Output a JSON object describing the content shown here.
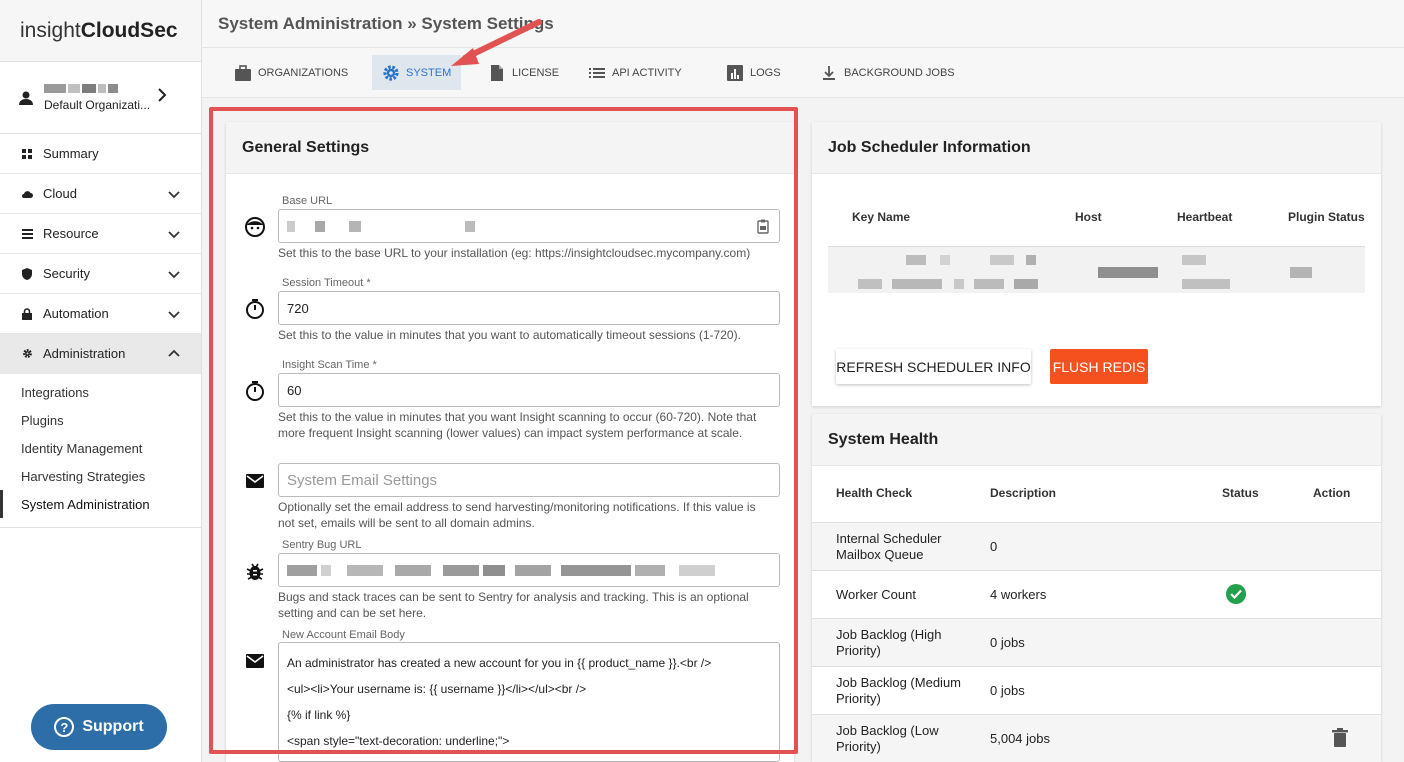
{
  "app": {
    "logo_light": "insight",
    "logo_bold": "CloudSec"
  },
  "org": {
    "name": "Default Organizati..."
  },
  "nav": {
    "items": [
      {
        "label": "Summary",
        "icon": "grid-icon"
      },
      {
        "label": "Cloud",
        "icon": "cloud-icon"
      },
      {
        "label": "Resource",
        "icon": "list-icon"
      },
      {
        "label": "Security",
        "icon": "shield-icon"
      },
      {
        "label": "Automation",
        "icon": "lock-icon"
      },
      {
        "label": "Administration",
        "icon": "gear-icon"
      }
    ],
    "sub_items": [
      {
        "label": "Integrations"
      },
      {
        "label": "Plugins"
      },
      {
        "label": "Identity Management"
      },
      {
        "label": "Harvesting Strategies"
      },
      {
        "label": "System Administration"
      }
    ]
  },
  "support": {
    "label": "Support"
  },
  "header": {
    "title": "System Administration » System Settings"
  },
  "tabs": [
    {
      "label": "ORGANIZATIONS",
      "icon": "briefcase-icon"
    },
    {
      "label": "SYSTEM",
      "icon": "gear-icon"
    },
    {
      "label": "LICENSE",
      "icon": "document-icon"
    },
    {
      "label": "API ACTIVITY",
      "icon": "list-icon"
    },
    {
      "label": "LOGS",
      "icon": "bar-chart-icon"
    },
    {
      "label": "BACKGROUND JOBS",
      "icon": "download-icon"
    }
  ],
  "general": {
    "title": "General Settings",
    "base_url": {
      "label": "Base URL",
      "help": "Set this to the base URL to your installation (eg: https://insightcloudsec.mycompany.com)"
    },
    "session_timeout": {
      "label": "Session Timeout *",
      "value": "720",
      "help": "Set this to the value in minutes that you want to automatically timeout sessions (1-720)."
    },
    "scan_time": {
      "label": "Insight Scan Time *",
      "value": "60",
      "help1": "Set this to the value in minutes that you want Insight scanning to occur (60-720). Note that",
      "help2": "more frequent Insight scanning (lower values) can impact system performance at scale."
    },
    "email": {
      "placeholder": "System Email Settings",
      "help1": "Optionally set the email address to send harvesting/monitoring notifications. If this value is",
      "help2": "not set, emails will be sent to all domain admins."
    },
    "sentry": {
      "label": "Sentry Bug URL",
      "help1": "Bugs and stack traces can be sent to Sentry for analysis and tracking. This is an optional",
      "help2": "setting and can be set here."
    },
    "account_email": {
      "label": "New Account Email Body",
      "lines": [
        "An administrator has created a new account for you in {{ product_name }}.<br />",
        "<ul><li>Your username is: {{ username }}</li></ul><br />",
        "{% if link %}",
        "<span style=\"text-decoration: underline;\">"
      ]
    }
  },
  "job_scheduler": {
    "title": "Job Scheduler Information",
    "columns": [
      "Key Name",
      "Host",
      "Heartbeat",
      "Plugin Status"
    ],
    "refresh_label": "REFRESH SCHEDULER INFO",
    "flush_label": "FLUSH REDIS"
  },
  "system_health": {
    "title": "System Health",
    "columns": [
      "Health Check",
      "Description",
      "Status",
      "Action"
    ],
    "rows": [
      {
        "check1": "Internal Scheduler",
        "check2": "Mailbox Queue",
        "desc": "0"
      },
      {
        "check1": "Worker Count",
        "check2": "",
        "desc": "4 workers"
      },
      {
        "check1": "Job Backlog (High",
        "check2": "Priority)",
        "desc": "0 jobs"
      },
      {
        "check1": "Job Backlog (Medium",
        "check2": "Priority)",
        "desc": "0 jobs"
      },
      {
        "check1": "Job Backlog (Low",
        "check2": "Priority)",
        "desc": "5,004 jobs"
      }
    ]
  },
  "colors": {
    "accent": "#2a73c6",
    "highlight": "#e35252",
    "flush": "#f4511e",
    "ok": "#22a04b"
  }
}
